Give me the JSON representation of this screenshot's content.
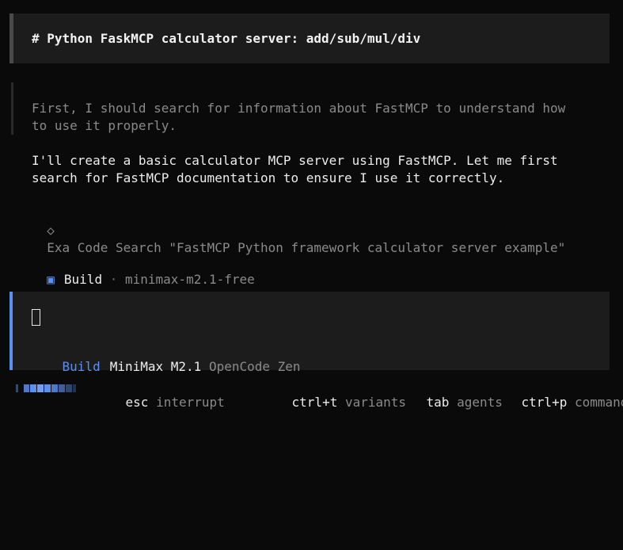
{
  "session": {
    "user_message": "# Python FaskMCP calculator server: add/sub/mul/div"
  },
  "assistant": {
    "reasoning": [
      "First, I should search for information about FastMCP to understand how",
      "to use it properly."
    ],
    "response": [
      "I'll create a basic calculator MCP server using FastMCP. Let me first",
      "search for FastMCP documentation to ensure I use it correctly."
    ],
    "tool_call": {
      "icon": "diamond-icon",
      "glyph": "◇",
      "text": "Exa Code Search \"FastMCP Python framework calculator server example\""
    },
    "build": {
      "glyph": "▣",
      "label": "Build",
      "separator": "·",
      "model": "minimax-m2.1-free"
    }
  },
  "input": {
    "agent": "Build",
    "model": "MiniMax M2.1",
    "provider": "OpenCode Zen"
  },
  "footer": {
    "hints": [
      {
        "key": "esc",
        "desc": "interrupt"
      },
      {
        "key": "ctrl+t",
        "desc": "variants"
      },
      {
        "key": "tab",
        "desc": "agents"
      },
      {
        "key": "ctrl+p",
        "desc": "commands"
      }
    ]
  },
  "colors": {
    "accent": "#5b8ff0",
    "panel": "#1c1c1c",
    "background": "#0a0a0a"
  }
}
